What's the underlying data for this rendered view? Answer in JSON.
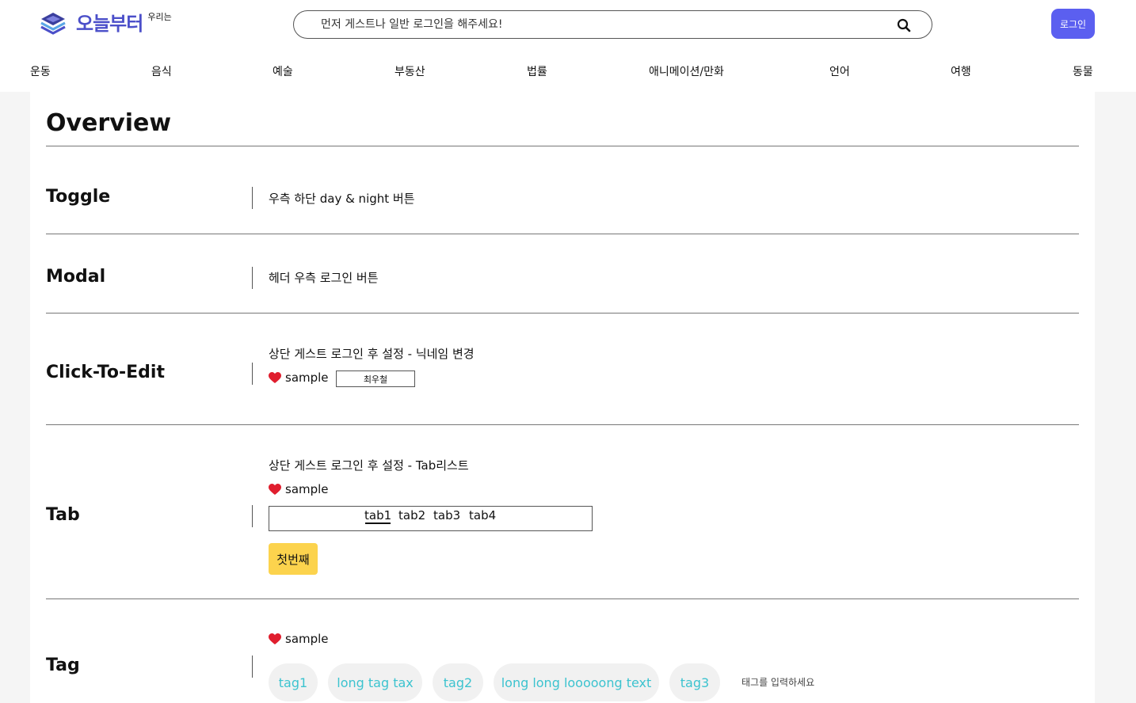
{
  "header": {
    "logo_text": "오늘부터",
    "logo_sub": "우리는",
    "search_placeholder": "먼저 게스트나 일반 로그인을 해주세요!",
    "login_label": "로그인",
    "brand_color": "#4b4fc9",
    "button_color": "#5b5ff0"
  },
  "nav": {
    "items": [
      {
        "label": "운동"
      },
      {
        "label": "음식"
      },
      {
        "label": "예술"
      },
      {
        "label": "부동산"
      },
      {
        "label": "법률"
      },
      {
        "label": "애니메이션/만화"
      },
      {
        "label": "언어"
      },
      {
        "label": "여행"
      },
      {
        "label": "동물"
      }
    ]
  },
  "main": {
    "title": "Overview",
    "sections": {
      "toggle": {
        "title": "Toggle",
        "desc": "우측 하단 day & night 버튼"
      },
      "modal": {
        "title": "Modal",
        "desc": "헤더 우측 로그인 버튼"
      },
      "click_to_edit": {
        "title": "Click-To-Edit",
        "desc": "상단 게스트 로그인 후 설정 - 닉네임 변경",
        "sample_label": "sample",
        "edit_value": "최우철"
      },
      "tab": {
        "title": "Tab",
        "desc": "상단 게스트 로그인 후 설정 - Tab리스트",
        "sample_label": "sample",
        "tabs": [
          "tab1",
          "tab2",
          "tab3",
          "tab4"
        ],
        "content": "첫번째",
        "content_color": "#fcd34d"
      },
      "tag": {
        "title": "Tag",
        "sample_label": "sample",
        "tags": [
          "tag1",
          "long tag tax",
          "tag2",
          "long long looooong text",
          "tag3"
        ],
        "input_placeholder": "태그를 입력하세요",
        "tag_color": "#3cc3cf"
      }
    }
  }
}
